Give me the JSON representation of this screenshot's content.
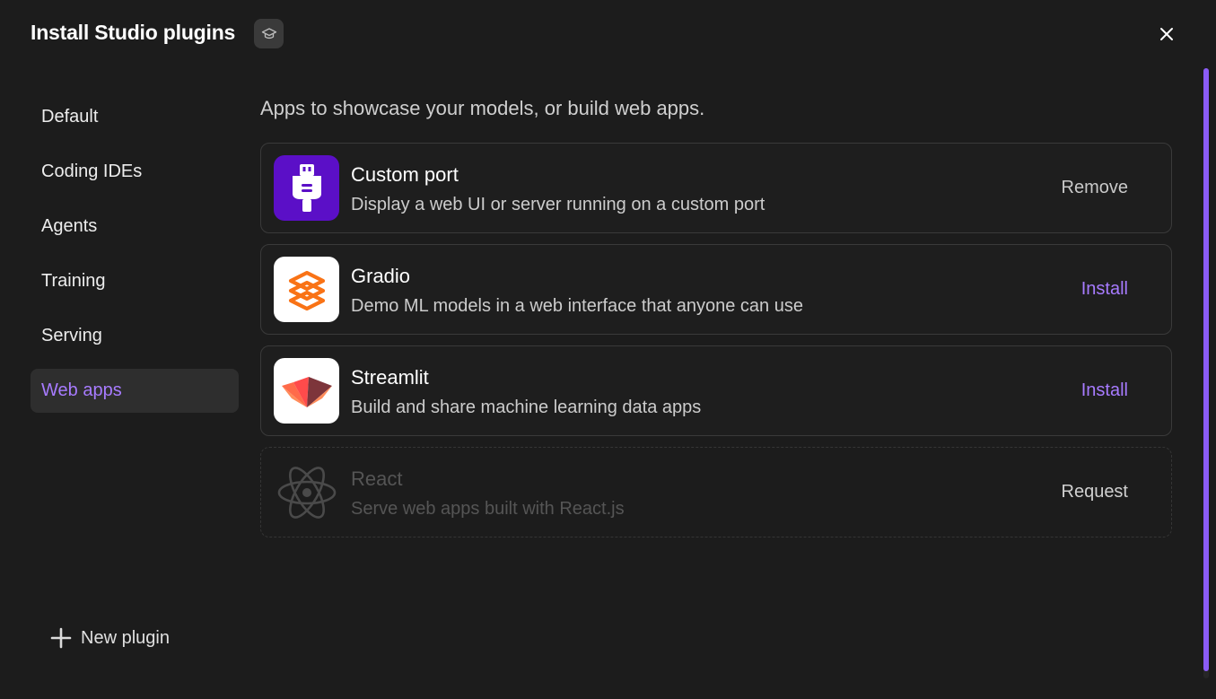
{
  "header": {
    "title": "Install Studio plugins",
    "badge_icon": "graduation-cap-icon",
    "close_icon": "close-icon"
  },
  "sidebar": {
    "items": [
      {
        "label": "Default"
      },
      {
        "label": "Coding IDEs"
      },
      {
        "label": "Agents"
      },
      {
        "label": "Training"
      },
      {
        "label": "Serving"
      },
      {
        "label": "Web apps",
        "active": true
      }
    ],
    "new_plugin_label": "New plugin"
  },
  "main": {
    "subtitle": "Apps to showcase your models, or build web apps.",
    "plugins": [
      {
        "name": "Custom port",
        "description": "Display a web UI or server running on a custom port",
        "action": "Remove",
        "icon": "plug-icon",
        "icon_bg": "#5b0fc7"
      },
      {
        "name": "Gradio",
        "description": "Demo ML models in a web interface that anyone can use",
        "action": "Install",
        "icon": "gradio-logo-icon",
        "icon_bg": "#ffffff"
      },
      {
        "name": "Streamlit",
        "description": "Build and share machine learning data apps",
        "action": "Install",
        "icon": "streamlit-logo-icon",
        "icon_bg": "#ffffff"
      },
      {
        "name": "React",
        "description": "Serve web apps built with React.js",
        "action": "Request",
        "icon": "react-logo-icon",
        "disabled": true
      }
    ]
  },
  "colors": {
    "accent": "#a77bff",
    "background": "#1c1c1c",
    "scrollbar": "#8b5cf6"
  }
}
